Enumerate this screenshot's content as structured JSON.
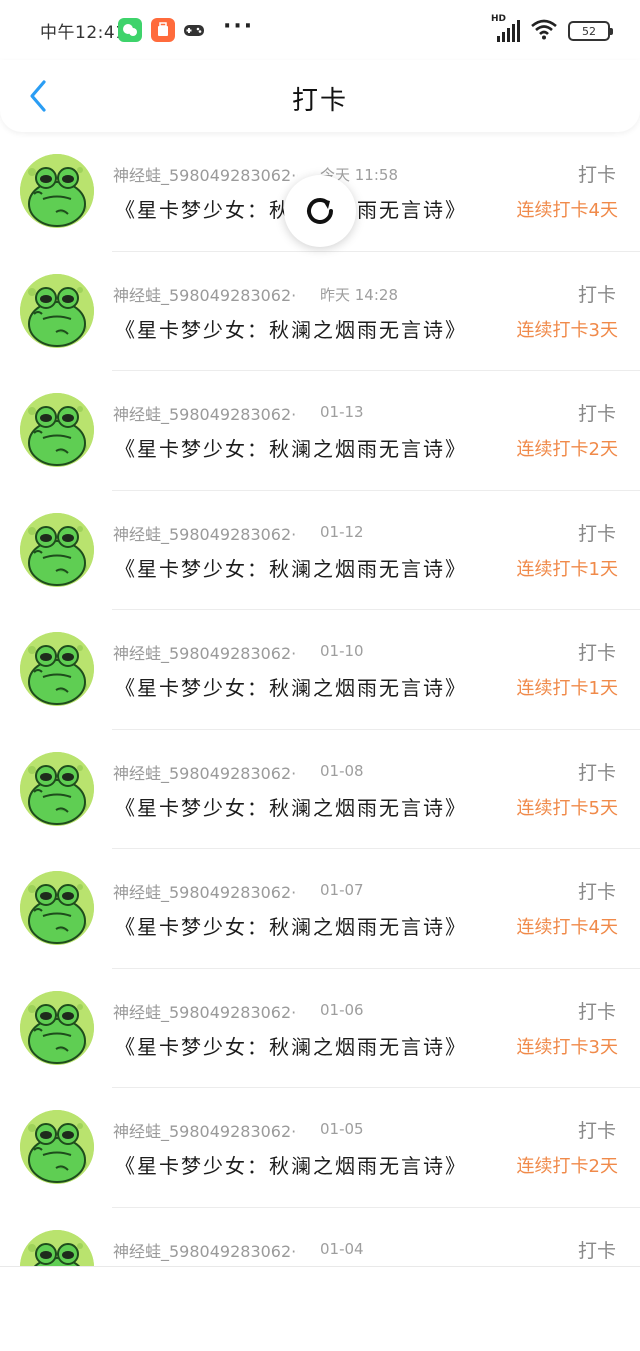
{
  "status_bar": {
    "time": "中午12:41",
    "more": "···",
    "network": "HD",
    "battery": "52"
  },
  "nav": {
    "title": "打卡"
  },
  "colors": {
    "accent_blue": "#2a9df4",
    "streak_orange": "#f08a4a",
    "frog_green": "#5fce53"
  },
  "checkins": [
    {
      "user": "神经蛙_598049283062···",
      "date": "今天 11:58",
      "action": "打卡",
      "book": "《星卡梦少女：秋澜之烟雨无言诗》",
      "streak": "连续打卡4天"
    },
    {
      "user": "神经蛙_598049283062···",
      "date": "昨天 14:28",
      "action": "打卡",
      "book": "《星卡梦少女：秋澜之烟雨无言诗》",
      "streak": "连续打卡3天"
    },
    {
      "user": "神经蛙_598049283062···",
      "date": "01-13",
      "action": "打卡",
      "book": "《星卡梦少女：秋澜之烟雨无言诗》",
      "streak": "连续打卡2天"
    },
    {
      "user": "神经蛙_598049283062···",
      "date": "01-12",
      "action": "打卡",
      "book": "《星卡梦少女：秋澜之烟雨无言诗》",
      "streak": "连续打卡1天"
    },
    {
      "user": "神经蛙_598049283062···",
      "date": "01-10",
      "action": "打卡",
      "book": "《星卡梦少女：秋澜之烟雨无言诗》",
      "streak": "连续打卡1天"
    },
    {
      "user": "神经蛙_598049283062···",
      "date": "01-08",
      "action": "打卡",
      "book": "《星卡梦少女：秋澜之烟雨无言诗》",
      "streak": "连续打卡5天"
    },
    {
      "user": "神经蛙_598049283062···",
      "date": "01-07",
      "action": "打卡",
      "book": "《星卡梦少女：秋澜之烟雨无言诗》",
      "streak": "连续打卡4天"
    },
    {
      "user": "神经蛙_598049283062···",
      "date": "01-06",
      "action": "打卡",
      "book": "《星卡梦少女：秋澜之烟雨无言诗》",
      "streak": "连续打卡3天"
    },
    {
      "user": "神经蛙_598049283062···",
      "date": "01-05",
      "action": "打卡",
      "book": "《星卡梦少女：秋澜之烟雨无言诗》",
      "streak": "连续打卡2天"
    },
    {
      "user": "神经蛙_598049283062···",
      "date": "01-04",
      "action": "打卡",
      "book": "",
      "streak": ""
    }
  ],
  "icons": {
    "back": "chevron-left-icon",
    "refresh": "refresh-icon",
    "avatar": "frog-avatar"
  }
}
